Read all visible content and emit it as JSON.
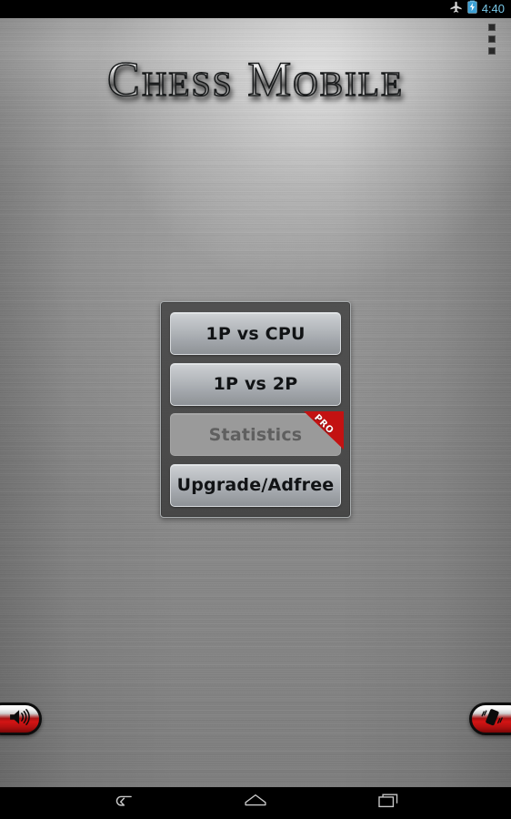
{
  "status_bar": {
    "time": "4:40",
    "icons": [
      "airplane-mode-icon",
      "battery-charging-icon"
    ],
    "time_color": "#79c8e8",
    "battery_color": "#3b9fd4",
    "background": "#000000"
  },
  "app": {
    "title": "Chess Mobile",
    "background_style": "brushed-metal-grey",
    "overflow_menu": {
      "name": "overflow-menu-button",
      "dots": 3
    }
  },
  "menu": {
    "panel_bg": "#4a4a4a",
    "panel_border": "#a8acae",
    "buttons": [
      {
        "label": "1P vs CPU",
        "enabled": true,
        "badge": null
      },
      {
        "label": "1P vs 2P",
        "enabled": true,
        "badge": null
      },
      {
        "label": "Statistics",
        "enabled": false,
        "badge": "PRO"
      },
      {
        "label": "Upgrade/Adfree",
        "enabled": true,
        "badge": null
      }
    ],
    "badge_color": "#c31212"
  },
  "toolbar": {
    "sound_button": {
      "label": "sound-toggle",
      "icon": "speaker-volume-icon"
    },
    "vibrate_button": {
      "label": "vibrate-toggle",
      "icon": "vibrate-icon"
    },
    "accent_color": "#c31212"
  },
  "nav_bar": {
    "buttons": [
      {
        "name": "back-button",
        "icon": "back-arrow-icon"
      },
      {
        "name": "home-button",
        "icon": "home-icon"
      },
      {
        "name": "recents-button",
        "icon": "recent-apps-icon"
      }
    ],
    "background": "#000000"
  }
}
